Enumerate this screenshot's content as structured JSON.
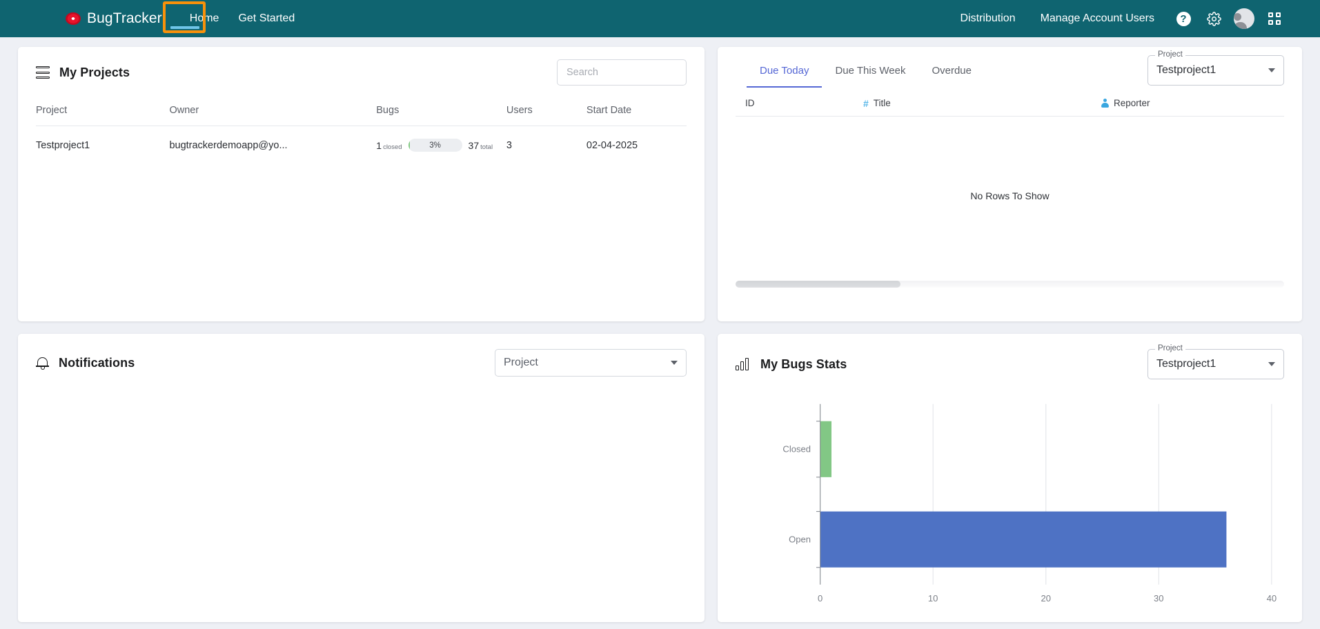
{
  "navbar": {
    "brand": "BugTracker",
    "logo_icon": "bug-logo-icon",
    "links": [
      "Home",
      "Get Started"
    ],
    "home_label": "Home",
    "get_started_label": "Get Started",
    "right_links": [
      "Distribution",
      "Manage Account Users"
    ],
    "distribution_label": "Distribution",
    "manage_users_label": "Manage Account Users",
    "help_glyph": "?",
    "icons": [
      "help-icon",
      "gear-icon",
      "avatar",
      "apps-grid-icon"
    ],
    "bg_color": "#0f6470",
    "highlight_color": "#f7910b",
    "active_underline_color": "#6fc5e8"
  },
  "my_projects": {
    "icon": "stack-icon",
    "title": "My Projects",
    "search": {
      "value": "",
      "placeholder": "Search"
    },
    "columns": [
      "Project",
      "Owner",
      "Bugs",
      "Users",
      "Start Date"
    ],
    "rows": [
      {
        "project": "Testproject1",
        "owner": "bugtrackerdemoapp@yo...",
        "bugs_closed": "1",
        "bugs_closed_label": "closed",
        "bugs_percent": "3%",
        "bugs_percent_value": 3,
        "bugs_total": "37",
        "bugs_total_label": "total",
        "users": "3",
        "start_date": "02-04-2025"
      }
    ],
    "progress_color": "#7fc97f"
  },
  "due_panel": {
    "tabs": [
      {
        "label": "Due Today",
        "active": true
      },
      {
        "label": "Due This Week",
        "active": false
      },
      {
        "label": "Overdue",
        "active": false
      }
    ],
    "project_select": {
      "label": "Project",
      "value": "Testproject1"
    },
    "grid_columns": [
      {
        "label": "ID",
        "icon": ""
      },
      {
        "label": "Title",
        "icon": "hash-icon"
      },
      {
        "label": "Reporter",
        "icon": "person-icon"
      }
    ],
    "empty_message": "No Rows To Show",
    "active_tab_color": "#5567d5",
    "scrollbar_thumb_percent": 30
  },
  "notifications": {
    "icon": "bell-icon",
    "title": "Notifications",
    "project_select": {
      "placeholder": "Project",
      "value": ""
    }
  },
  "bugs_stats": {
    "icon": "chart-icon",
    "title": "My Bugs Stats",
    "project_select": {
      "label": "Project",
      "value": "Testproject1"
    }
  },
  "chart_data": {
    "type": "bar",
    "orientation": "horizontal",
    "title": "My Bugs Stats",
    "categories": [
      "Closed",
      "Open"
    ],
    "values": [
      1,
      36
    ],
    "colors": [
      "#82c785",
      "#4e72c4"
    ],
    "xlabel": "",
    "ylabel": "",
    "xlim": [
      0,
      40
    ],
    "xticks": [
      0,
      10,
      20,
      30,
      40
    ],
    "xtick_labels": [
      "0",
      "10",
      "20",
      "30",
      "40"
    ],
    "grid": true,
    "legend": false
  }
}
